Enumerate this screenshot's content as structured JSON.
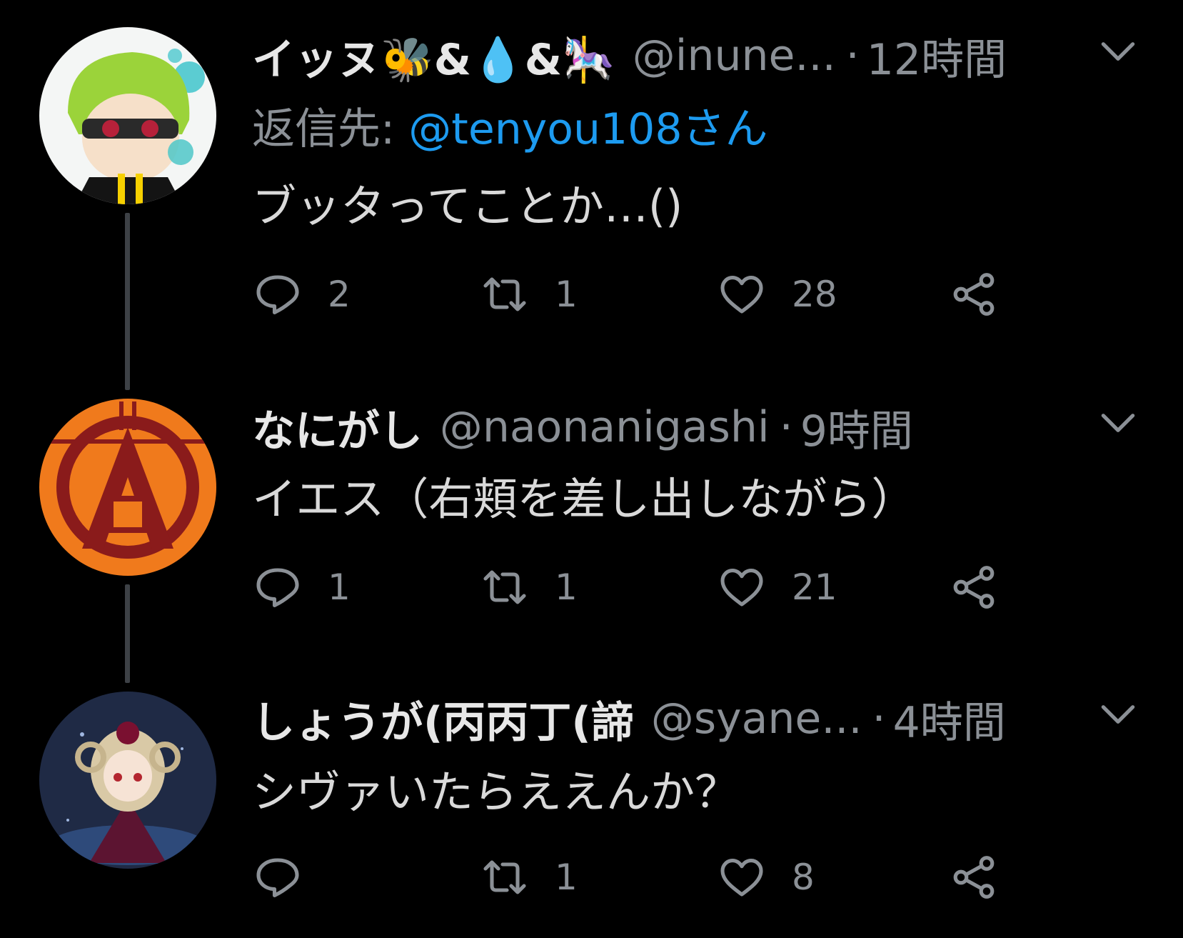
{
  "tweets": [
    {
      "name": "イッヌ🐝&💧&🎠",
      "handle": "@inune...",
      "dot": "·",
      "time": "12時間",
      "reply_to_prefix": "返信先:",
      "reply_to_mention": "@tenyou108さん",
      "text": "ブッタってことか…()",
      "reply_count": "2",
      "retweet_count": "1",
      "like_count": "28"
    },
    {
      "name": "なにがし",
      "handle": "@naonanigashi",
      "dot": "·",
      "time": "9時間",
      "text": "イエス（右頬を差し出しながら）",
      "reply_count": "1",
      "retweet_count": "1",
      "like_count": "21"
    },
    {
      "name": "しょうが(丙丙丁(諦",
      "handle": "@syane...",
      "dot": "·",
      "time": "4時間",
      "text": "シヴァいたらええんか？",
      "reply_count": "",
      "retweet_count": "1",
      "like_count": "8"
    }
  ],
  "icons": {
    "reply": "speech-bubble-icon",
    "retweet": "retweet-icon",
    "like": "heart-icon",
    "share": "share-icon",
    "menu": "chevron-down-icon"
  },
  "colors": {
    "background": "#000000",
    "text": "#d9d9d9",
    "secondary": "#8b9096",
    "mention": "#1d9bf0",
    "thread_line": "#3d4146"
  }
}
